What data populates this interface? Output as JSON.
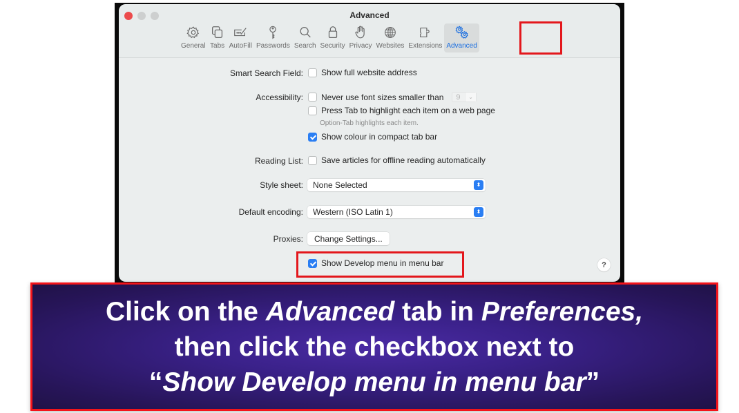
{
  "window": {
    "title": "Advanced",
    "traffic_lights": [
      "close",
      "minimize",
      "zoom"
    ]
  },
  "tabs": [
    {
      "label": "General",
      "icon": "gear-icon",
      "active": false
    },
    {
      "label": "Tabs",
      "icon": "tabs-icon",
      "active": false
    },
    {
      "label": "AutoFill",
      "icon": "autofill-icon",
      "active": false
    },
    {
      "label": "Passwords",
      "icon": "key-icon",
      "active": false
    },
    {
      "label": "Search",
      "icon": "search-icon",
      "active": false
    },
    {
      "label": "Security",
      "icon": "lock-icon",
      "active": false
    },
    {
      "label": "Privacy",
      "icon": "hand-icon",
      "active": false
    },
    {
      "label": "Websites",
      "icon": "globe-icon",
      "active": false
    },
    {
      "label": "Extensions",
      "icon": "puzzle-icon",
      "active": false
    },
    {
      "label": "Advanced",
      "icon": "gears-icon",
      "active": true
    }
  ],
  "settings": {
    "smart_search": {
      "label": "Smart Search Field:",
      "option": "Show full website address",
      "checked": false
    },
    "accessibility": {
      "label": "Accessibility:",
      "never_font": {
        "label": "Never use font sizes smaller than",
        "checked": false,
        "value": "9",
        "chevron": "⌄"
      },
      "press_tab": {
        "label": "Press Tab to highlight each item on a web page",
        "checked": false
      },
      "hint": "Option-Tab highlights each item.",
      "show_colour": {
        "label": "Show colour in compact tab bar",
        "checked": true
      }
    },
    "reading_list": {
      "label": "Reading List:",
      "option": "Save articles for offline reading automatically",
      "checked": false
    },
    "style_sheet": {
      "label": "Style sheet:",
      "value": "None Selected"
    },
    "default_encoding": {
      "label": "Default encoding:",
      "value": "Western (ISO Latin 1)"
    },
    "proxies": {
      "label": "Proxies:",
      "button": "Change Settings..."
    },
    "develop_menu": {
      "label": "Show Develop menu in menu bar",
      "checked": true
    },
    "help": "?"
  },
  "colors": {
    "highlight_red": "#e3171c",
    "accent_blue": "#2a7ef3",
    "banner_purple": "#3a2189"
  },
  "banner": {
    "line1": {
      "pre": "Click on the ",
      "em1": "Advanced",
      "mid": " tab in ",
      "em2": "Preferences,"
    },
    "line2": "then click the checkbox next to",
    "line3": {
      "open_quote": "“",
      "em": "Show Develop menu in menu bar",
      "close_quote": "”"
    }
  }
}
